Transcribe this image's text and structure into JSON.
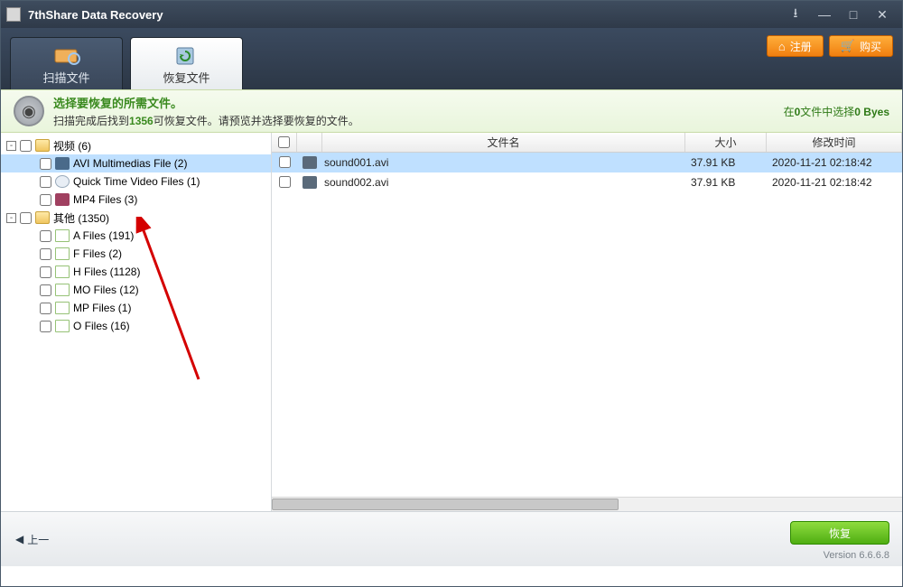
{
  "title": "7thShare Data Recovery",
  "toolbar": {
    "tab_scan": "扫描文件",
    "tab_recover": "恢复文件",
    "btn_register": "注册",
    "btn_buy": "购买"
  },
  "banner": {
    "line1": "选择要恢复的所需文件。",
    "line2_pre": "扫描完成后找到",
    "line2_num": "1356",
    "line2_post": "可恢复文件。请预览并选择要恢复的文件。",
    "right_pre": "在",
    "right_count": "0",
    "right_mid": "文件中选择",
    "right_size": "0 Byes"
  },
  "tree": [
    {
      "indent": 0,
      "twist": "-",
      "label": "视频 (6)",
      "icon": "folder"
    },
    {
      "indent": 1,
      "twist": "",
      "label": "AVI Multimedias File (2)",
      "icon": "avi",
      "sel": true
    },
    {
      "indent": 1,
      "twist": "",
      "label": "Quick Time Video Files (1)",
      "icon": "qt"
    },
    {
      "indent": 1,
      "twist": "",
      "label": "MP4 Files (3)",
      "icon": "mp4"
    },
    {
      "indent": 0,
      "twist": "-",
      "label": "其他 (1350)",
      "icon": "folder"
    },
    {
      "indent": 1,
      "twist": "",
      "label": "A Files (191)",
      "icon": "txt"
    },
    {
      "indent": 1,
      "twist": "",
      "label": "F Files (2)",
      "icon": "txt"
    },
    {
      "indent": 1,
      "twist": "",
      "label": "H Files (1128)",
      "icon": "txt"
    },
    {
      "indent": 1,
      "twist": "",
      "label": "MO Files (12)",
      "icon": "txt"
    },
    {
      "indent": 1,
      "twist": "",
      "label": "MP Files (1)",
      "icon": "txt"
    },
    {
      "indent": 1,
      "twist": "",
      "label": "O Files (16)",
      "icon": "txt"
    }
  ],
  "cols": {
    "name": "文件名",
    "size": "大小",
    "date": "修改时间"
  },
  "files": [
    {
      "name": "sound001.avi",
      "size": "37.91 KB",
      "date": "2020-11-21 02:18:42",
      "sel": true
    },
    {
      "name": "sound002.avi",
      "size": "37.91 KB",
      "date": "2020-11-21 02:18:42"
    }
  ],
  "footer": {
    "back": "上一",
    "recover": "恢复",
    "version": "Version 6.6.6.8"
  }
}
